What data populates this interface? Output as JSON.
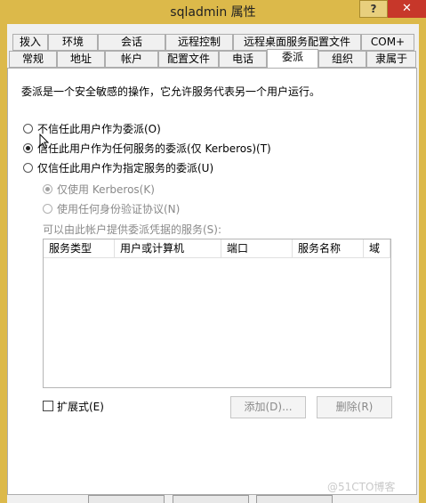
{
  "window": {
    "title": "sqladmin 属性",
    "help_label": "?",
    "close_label": "✕"
  },
  "tabs_row1": [
    "拨入",
    "环境",
    "会话",
    "远程控制",
    "远程桌面服务配置文件",
    "COM+"
  ],
  "tabs_row2": [
    "常规",
    "地址",
    "帐户",
    "配置文件",
    "电话",
    "委派",
    "组织",
    "隶属于"
  ],
  "active_tab": "委派",
  "description": "委派是一个安全敏感的操作，它允许服务代表另一个用户运行。",
  "options": {
    "no_trust": "不信任此用户作为委派(O)",
    "trust_any": "信任此用户作为任何服务的委派(仅 Kerberos)(T)",
    "trust_specified": "仅信任此用户作为指定服务的委派(U)",
    "kerberos_only": "仅使用 Kerberos(K)",
    "any_protocol": "使用任何身份验证协议(N)"
  },
  "services_label": "可以由此帐户提供委派凭据的服务(S):",
  "columns": [
    "服务类型",
    "用户或计算机",
    "端口",
    "服务名称",
    "域"
  ],
  "expanded_label": "扩展式(E)",
  "add_button": "添加(D)...",
  "remove_button": "删除(R)",
  "watermark": "@51CTO博客"
}
